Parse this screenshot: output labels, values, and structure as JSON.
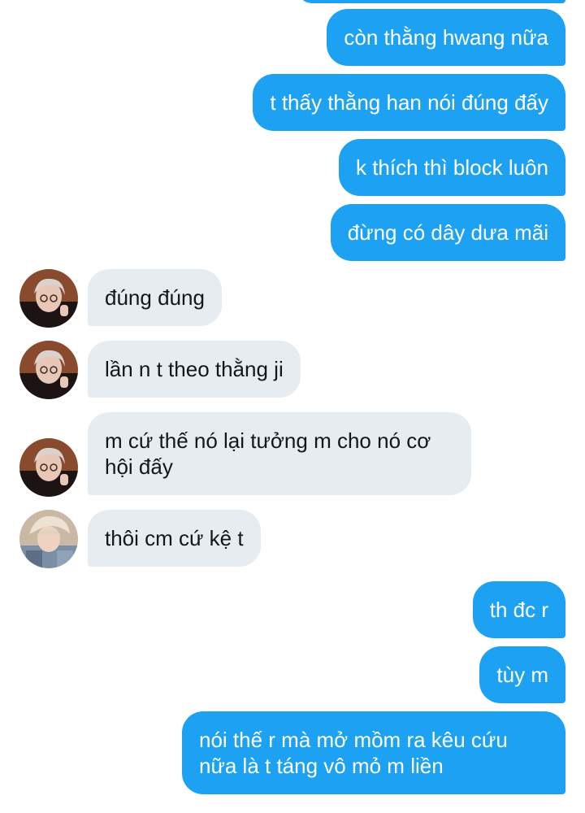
{
  "conversation": {
    "messages": [
      {
        "id": "m1",
        "side": "out",
        "text": "còn thằng hwang nữa"
      },
      {
        "id": "m2",
        "side": "out",
        "text": "t thấy thằng han nói đúng đấy"
      },
      {
        "id": "m3",
        "side": "out",
        "text": "k thích thì block luôn"
      },
      {
        "id": "m4",
        "side": "out",
        "text": "đừng có dây dưa mãi"
      },
      {
        "id": "m5",
        "side": "in",
        "avatar": "user-a",
        "text": "đúng đúng"
      },
      {
        "id": "m6",
        "side": "in",
        "avatar": "user-a",
        "text": "lần n t theo thằng ji"
      },
      {
        "id": "m7",
        "side": "in",
        "avatar": "user-a",
        "text": "m cứ thế nó lại tưởng m cho nó cơ hội đấy"
      },
      {
        "id": "m8",
        "side": "in",
        "avatar": "user-b",
        "text": "thôi cm cứ kệ t"
      },
      {
        "id": "m9",
        "side": "out",
        "text": "th đc r"
      },
      {
        "id": "m10",
        "side": "out",
        "text": "tùy m"
      },
      {
        "id": "m11",
        "side": "out",
        "text": "nói thế r mà mở mồm ra kêu cứu nữa là t táng vô mỏ m liền"
      }
    ]
  },
  "colors": {
    "outgoing_bubble": "#1da1f2",
    "incoming_bubble": "#e6ecf0",
    "outgoing_text": "#ffffff",
    "incoming_text": "#14171a",
    "background": "#ffffff"
  }
}
